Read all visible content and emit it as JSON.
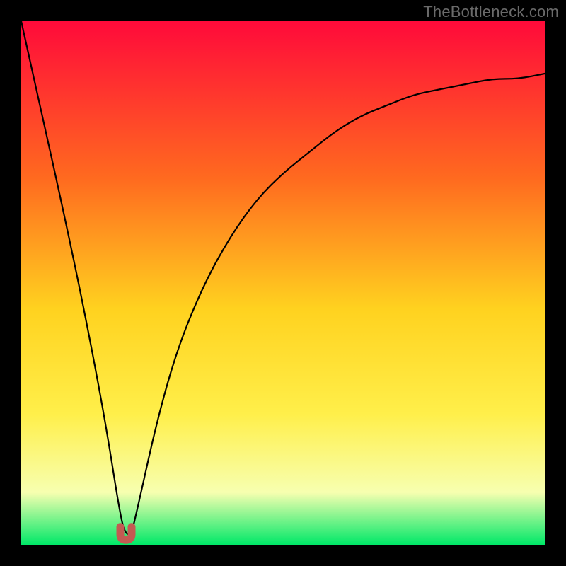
{
  "watermark": "TheBottleneck.com",
  "colors": {
    "frame": "#000000",
    "gradient_top": "#ff0a3a",
    "gradient_mid1": "#ff6a1f",
    "gradient_mid2": "#ffd21f",
    "gradient_mid3": "#ffef4a",
    "gradient_mid4": "#f7ffb0",
    "gradient_bottom": "#00e868",
    "curve": "#000000",
    "marker": "#c35a52"
  },
  "chart_data": {
    "type": "line",
    "title": "",
    "xlabel": "",
    "ylabel": "",
    "xlim": [
      0,
      100
    ],
    "ylim": [
      0,
      100
    ],
    "grid": false,
    "note": "Values are approximate pixel-read estimates of the black curve height (0 = bottom/green, 100 = top/red) across x. Minimum near x≈20.",
    "series": [
      {
        "name": "bottleneck-curve",
        "x": [
          0,
          4,
          8,
          12,
          16,
          19,
          20,
          21,
          22,
          26,
          30,
          35,
          40,
          45,
          50,
          55,
          60,
          65,
          70,
          75,
          80,
          85,
          90,
          95,
          100
        ],
        "values": [
          100,
          82,
          64,
          45,
          24,
          5,
          2,
          2,
          6,
          24,
          38,
          50,
          59,
          66,
          71,
          75,
          79,
          82,
          84,
          86,
          87,
          88,
          89,
          89,
          90
        ]
      }
    ],
    "marker": {
      "x": 20,
      "y": 2,
      "shape": "u",
      "color": "#c35a52"
    }
  }
}
